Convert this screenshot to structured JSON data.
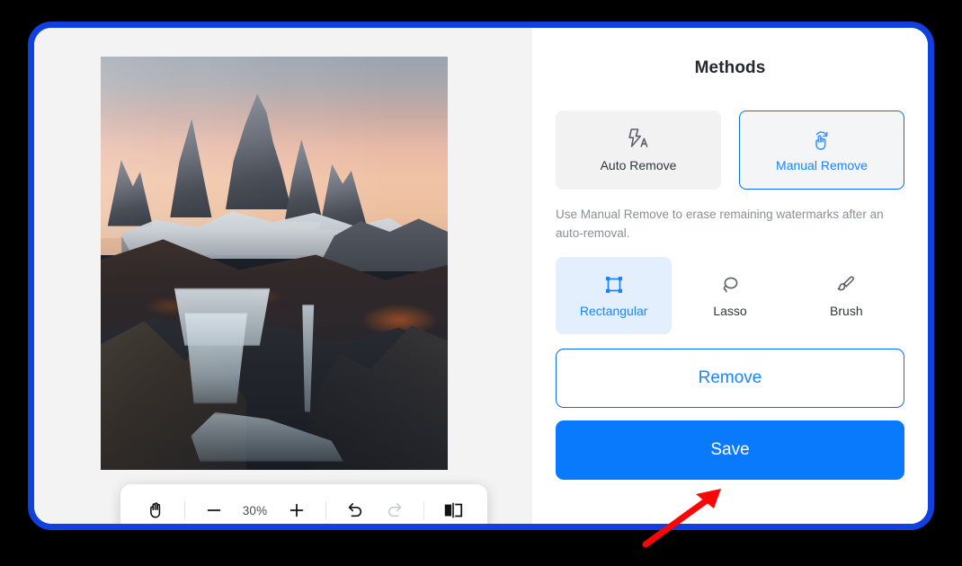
{
  "theme": {
    "frame_border_color": "#1040e0",
    "accent_blue": "#0a7afc",
    "accent_blue_text": "#1a84ff",
    "panel_bg": "#ffffff",
    "canvas_bg": "#f3f3f3",
    "annotation_color": "#ff0000"
  },
  "editor": {
    "image": {
      "alt": "Mountain landscape with snowy peaks at sunset and a long-exposure waterfall",
      "name": "watermark-editor-photo"
    },
    "toolbar": {
      "pan_icon": "hand-icon",
      "zoom_out_icon": "minus-icon",
      "zoom_level": "30%",
      "zoom_in_icon": "plus-icon",
      "undo_icon": "undo-icon",
      "redo_icon": "redo-icon",
      "compare_icon": "compare-split-icon",
      "redo_enabled": false
    }
  },
  "panel": {
    "title": "Methods",
    "methods": [
      {
        "label": "Auto Remove",
        "icon": "lightning-auto-icon",
        "selected": false
      },
      {
        "label": "Manual Remove",
        "icon": "hand-pointer-refresh-icon",
        "selected": true
      }
    ],
    "hint": "Use Manual Remove to erase remaining watermarks after an auto-removal.",
    "tools": [
      {
        "label": "Rectangular",
        "icon": "rectangular-marquee-icon",
        "selected": true
      },
      {
        "label": "Lasso",
        "icon": "lasso-icon",
        "selected": false
      },
      {
        "label": "Brush",
        "icon": "brush-icon",
        "selected": false
      }
    ],
    "remove_label": "Remove",
    "save_label": "Save"
  },
  "annotation": {
    "arrow": "red-arrow-pointing-at-save"
  }
}
